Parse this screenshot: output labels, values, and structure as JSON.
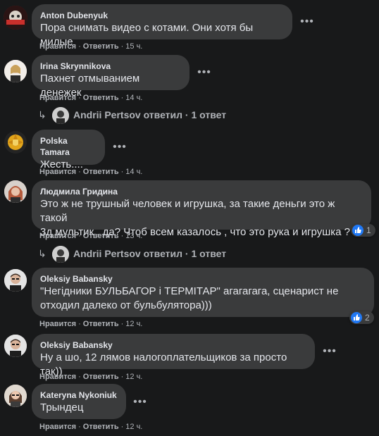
{
  "colors": {
    "background": "#18191a",
    "bubble": "#3a3b3c",
    "text": "#e4e6eb",
    "muted": "#b0b3b8",
    "like": "#2078f4"
  },
  "comments": [
    {
      "author": "Anton Dubenyuk",
      "text": [
        "Пора снимать видео с котами. Они хотя бы милые"
      ],
      "like": "Нравится",
      "reply": "Ответить",
      "time": "15 ч."
    },
    {
      "author": "Irina Skrynnikova",
      "text": [
        "Пахнет отмыванием денежек"
      ],
      "like": "Нравится",
      "reply": "Ответить",
      "time": "14 ч.",
      "replies": {
        "name": "Andrii Pertsov",
        "verb": "ответил",
        "count": "1 ответ"
      }
    },
    {
      "author": "Polska Tamara",
      "text": [
        "Жесть...."
      ],
      "like": "Нравится",
      "reply": "Ответить",
      "time": "14 ч."
    },
    {
      "author": "Людмила Гридина",
      "text": [
        "Это ж не трушный человек и игрушка, за такие деньги это ж такой",
        "3д мультик , да? Чтоб всем казалось , что это рука и игрушка ?"
      ],
      "like": "Нравится",
      "reply": "Ответить",
      "time": "13 ч.",
      "reactions": "1",
      "replies": {
        "name": "Andrii Pertsov",
        "verb": "ответил",
        "count": "1 ответ"
      }
    },
    {
      "author": "Oleksiy Babansky",
      "text": [
        "\"Негідники БУЛЬБАГОР і ТЕРМІТАР\" агагагага, сценарист не",
        "отходил далеко от бульбулятора)))"
      ],
      "like": "Нравится",
      "reply": "Ответить",
      "time": "12 ч.",
      "reactions": "2"
    },
    {
      "author": "Oleksiy Babansky",
      "text": [
        "Ну а шо, 12 лямов налогоплательщиков за просто так))"
      ],
      "like": "Нравится",
      "reply": "Ответить",
      "time": "12 ч."
    },
    {
      "author": "Kateryna Nykoniuk",
      "text": [
        "Трындец"
      ],
      "like": "Нравится",
      "reply": "Ответить",
      "time": "12 ч."
    }
  ]
}
